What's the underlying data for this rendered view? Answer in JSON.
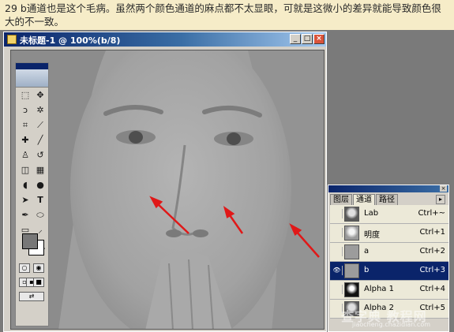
{
  "caption": "29 b通道也是这个毛病。虽然两个颜色通道的麻点都不太显眼，可就是这微小的差异就能导致颜色很大的不一致。",
  "document": {
    "title": "未标题-1 @ 100%(b/8)",
    "minimize": "_",
    "maximize": "□",
    "close": "×"
  },
  "channels_panel": {
    "tabs": [
      "图层",
      "通道",
      "路径"
    ],
    "active_tab": "通道",
    "rows": [
      {
        "name": "Lab",
        "shortcut": "Ctrl+~"
      },
      {
        "name": "明度",
        "shortcut": "Ctrl+1"
      },
      {
        "name": "a",
        "shortcut": "Ctrl+2"
      },
      {
        "name": "b",
        "shortcut": "Ctrl+3",
        "selected": true,
        "visible": true
      },
      {
        "name": "Alpha 1",
        "shortcut": "Ctrl+4"
      },
      {
        "name": "Alpha 2",
        "shortcut": "Ctrl+5"
      }
    ]
  },
  "watermark": {
    "text": "查字典 教程网",
    "url": "jiaocheng.chazidian.com"
  },
  "colors": {
    "desk": "#7a7a7a",
    "title_active": "#0a246a",
    "annotation_arrow": "#e01818"
  },
  "icons": [
    "marquee-icon",
    "move-icon",
    "lasso-icon",
    "magic-wand-icon",
    "crop-icon",
    "slice-icon",
    "healing-icon",
    "brush-icon",
    "stamp-icon",
    "history-brush-icon",
    "eraser-icon",
    "gradient-icon",
    "blur-icon",
    "dodge-icon",
    "path-select-icon",
    "type-icon",
    "pen-icon",
    "shape-icon",
    "notes-icon",
    "eyedropper-icon",
    "hand-icon",
    "zoom-icon"
  ]
}
